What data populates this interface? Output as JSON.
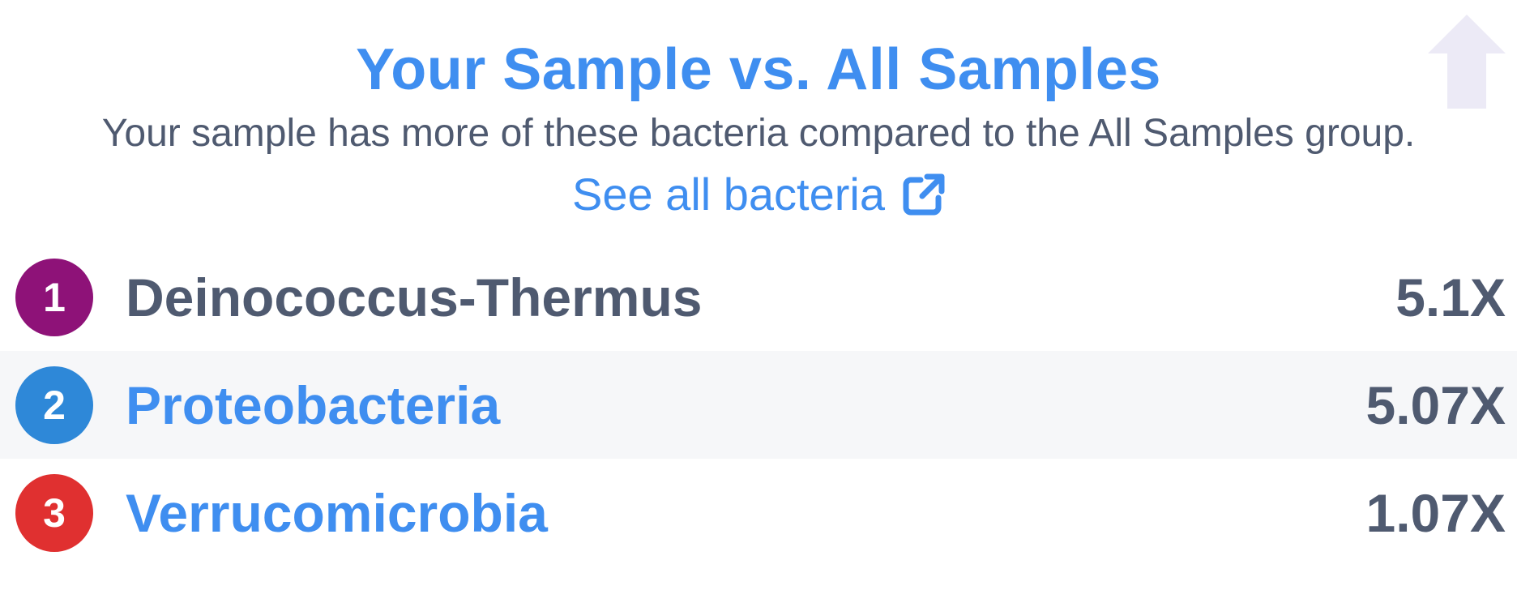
{
  "header": {
    "title": "Your Sample vs. All Samples",
    "subtitle": "Your sample has more of these bacteria compared to the All Samples group.",
    "see_all_label": "See all bacteria",
    "arrow_icon": "arrow-up-icon",
    "link_icon": "external-link-icon"
  },
  "colors": {
    "accent": "#3f8ef0",
    "text": "#4f5a70",
    "arrow": "#eceaf6",
    "row_shade": "#f6f7f9"
  },
  "bacteria": [
    {
      "rank": "1",
      "name": "Deinococcus-Thermus",
      "value": "5.1X",
      "badge_color": "#8e1278",
      "is_link": false
    },
    {
      "rank": "2",
      "name": "Proteobacteria",
      "value": "5.07X",
      "badge_color": "#2e88d8",
      "is_link": true
    },
    {
      "rank": "3",
      "name": "Verrucomicrobia",
      "value": "1.07X",
      "badge_color": "#e03030",
      "is_link": true
    }
  ]
}
